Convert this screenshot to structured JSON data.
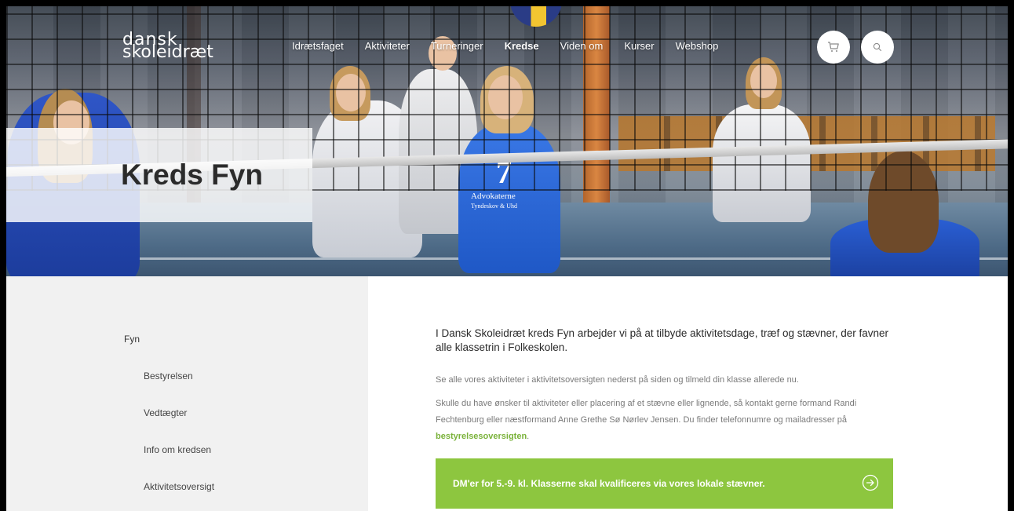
{
  "brand": {
    "logo_line1": "dansk",
    "logo_line2": "skoleidræt"
  },
  "nav": {
    "items": [
      "Idrætsfaget",
      "Aktiviteter",
      "Turneringer",
      "Kredse",
      "Viden om",
      "Kurser",
      "Webshop"
    ],
    "active": "Kredse"
  },
  "header_icons": {
    "cart": "cart-icon",
    "search": "search-icon"
  },
  "hero": {
    "title": "Kreds Fyn",
    "jersey_number": "7",
    "jersey_text": "Advokaterne",
    "jersey_text2": "Tyndeskov & Uhd"
  },
  "sidebar": {
    "items": [
      "Fyn",
      "Bestyrelsen",
      "Vedtægter",
      "Info om kredsen",
      "Aktivitetsoversigt"
    ]
  },
  "content": {
    "lead": "I Dansk Skoleidræt kreds Fyn arbejder vi på at tilbyde aktivitetsdage, træf og stævner, der favner alle klassetrin i Folkeskolen.",
    "para1": "Se alle vores aktiviteter i aktivitetsoversigten nederst på siden og tilmeld din klasse allerede nu.",
    "para2_text": "Skulle du have ønsker til aktiviteter eller placering af et stævne eller lignende, så kontakt gerne formand Randi Fechtenburg eller næstformand Anne Grethe Sø Nørlev Jensen. Du finder telefonnumre og mailadresser på",
    "para2_link": "bestyrelsesoversigten",
    "para2_end": ".",
    "cta_label": "DM'er for 5.-9. kl. Klasserne skal kvalificeres via vores lokale stævner."
  },
  "colors": {
    "accent_green": "#8dc63f",
    "link_green": "#7ab23a",
    "sidebar_bg": "#f1f1f1"
  }
}
